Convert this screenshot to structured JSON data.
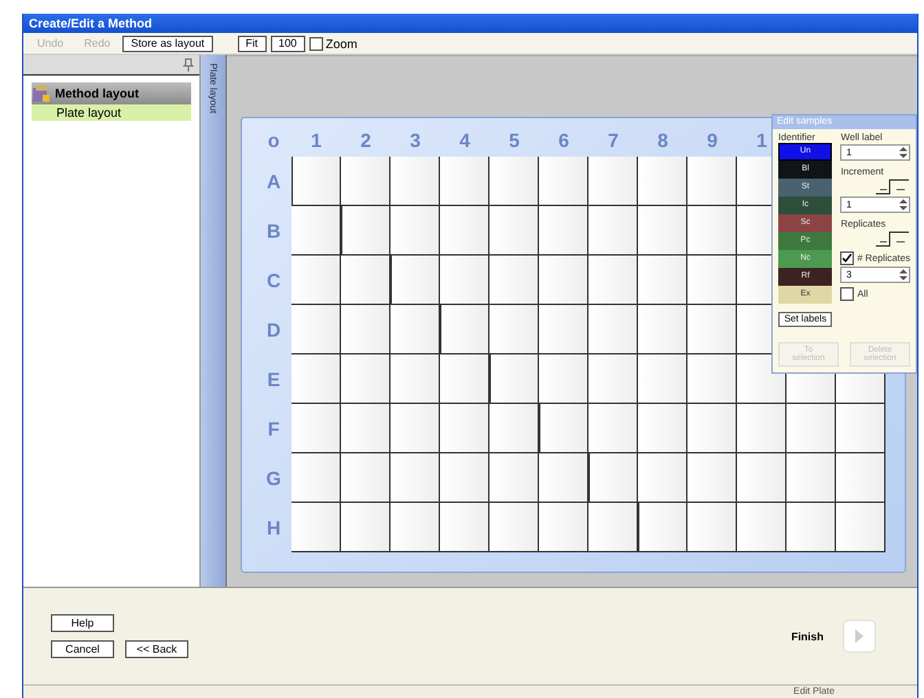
{
  "window": {
    "title": "Create/Edit a Method"
  },
  "toolbar": {
    "buttons": [
      {
        "label": "Undo",
        "disabled": true
      },
      {
        "label": "Redo",
        "disabled": true
      },
      {
        "label": "Store as layout",
        "disabled": false
      },
      {
        "label": "Fit",
        "disabled": false
      },
      {
        "label": "100",
        "disabled": false
      }
    ],
    "zoom_checkbox": {
      "label": "Zoom",
      "checked": false
    }
  },
  "tree": {
    "items": [
      {
        "label": "Method layout",
        "selected": true,
        "children": [
          {
            "label": "Plate layout",
            "selected": false
          }
        ]
      }
    ]
  },
  "side_tab": {
    "label": "Plate layout"
  },
  "plate": {
    "corner": "o",
    "columns": [
      "1",
      "2",
      "3",
      "4",
      "5",
      "6",
      "7",
      "8",
      "9",
      "1"
    ],
    "rows": [
      "A",
      "B",
      "C",
      "D",
      "E",
      "F",
      "G",
      "H"
    ]
  },
  "panel": {
    "title": "Edit samples",
    "legend_title": "Identifier",
    "legend": [
      {
        "label": "Un",
        "color": "#1010e8",
        "selected": true
      },
      {
        "label": "Bl",
        "color": "#101418",
        "selected": false
      },
      {
        "label": "St",
        "color": "#4a6270",
        "selected": false
      },
      {
        "label": "Ic",
        "color": "#2e4e3c",
        "selected": false
      },
      {
        "label": "Sc",
        "color": "#8a4444",
        "selected": false
      },
      {
        "label": "Pc",
        "color": "#3e7a3e",
        "selected": false
      },
      {
        "label": "Nc",
        "color": "#4c9a50",
        "selected": false
      },
      {
        "label": "Rf",
        "color": "#3c2222",
        "selected": false
      },
      {
        "label": "Ex",
        "color": "#e0d8a4",
        "selected": false
      }
    ],
    "set_labels": "Set labels",
    "well_label": {
      "label": "Well label",
      "value": "1"
    },
    "increment": {
      "label": "Increment",
      "value": "1"
    },
    "replicates": {
      "label": "Replicates"
    },
    "num_replicates": {
      "label": "# Replicates",
      "checked": true,
      "value": "3"
    },
    "all": {
      "label": "All",
      "checked": false
    },
    "actions": [
      {
        "label": "To selection",
        "disabled": true
      },
      {
        "label": "Delete selection",
        "disabled": true
      }
    ]
  },
  "footer": {
    "buttons": [
      {
        "label": "Help"
      },
      {
        "label": "Cancel"
      },
      {
        "label": "<< Back"
      }
    ],
    "finish": "Finish"
  },
  "status_bar": {
    "text": "Edit Plate"
  }
}
